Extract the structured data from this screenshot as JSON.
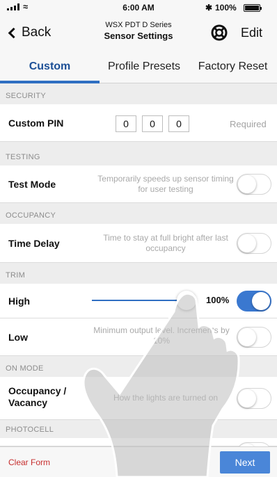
{
  "status_bar": {
    "time": "6:00 AM",
    "battery": "100%"
  },
  "nav": {
    "back_label": "Back",
    "subtitle": "WSX PDT D Series",
    "title": "Sensor Settings",
    "edit_label": "Edit"
  },
  "tabs": [
    {
      "label": "Custom",
      "active": true
    },
    {
      "label": "Profile Presets",
      "active": false
    },
    {
      "label": "Factory Reset",
      "active": false
    }
  ],
  "sections": {
    "security": "SECURITY",
    "testing": "TESTING",
    "occupancy": "OCCUPANCY",
    "trim": "TRIM",
    "on_mode": "ON MODE",
    "photocell": "PHOTOCELL"
  },
  "custom_pin": {
    "label": "Custom PIN",
    "digits": [
      "0",
      "0",
      "0"
    ],
    "status": "Required"
  },
  "test_mode": {
    "label": "Test Mode",
    "description": "Temporarily speeds up sensor timing for user testing",
    "enabled": false
  },
  "time_delay": {
    "label": "Time Delay",
    "description": "Time to stay at full bright after last occupancy",
    "enabled": false
  },
  "trim_high": {
    "label": "High",
    "value_text": "100%",
    "value": 100,
    "enabled": true
  },
  "trim_low": {
    "label": "Low",
    "description": "Minimum output level. Increments by 10%",
    "enabled": false
  },
  "on_mode": {
    "label": "Occupancy / Vacancy",
    "description": "How the lights are turned on",
    "enabled": false
  },
  "footer": {
    "clear_label": "Clear Form",
    "next_label": "Next"
  },
  "colors": {
    "accent": "#2f6fc2",
    "danger": "#c62d2d",
    "button": "#4a86d8"
  }
}
